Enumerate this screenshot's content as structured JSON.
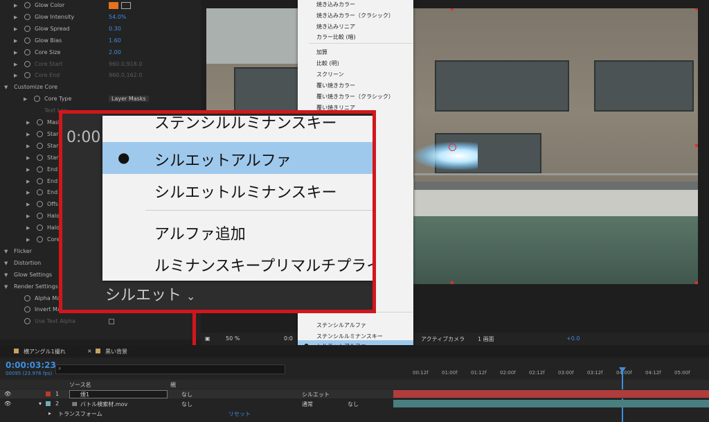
{
  "effect_controls": {
    "rows": [
      {
        "label": "Glow Color",
        "value": "",
        "type": "color"
      },
      {
        "label": "Glow Intensity",
        "value": "54.0%"
      },
      {
        "label": "Glow Spread",
        "value": "0.30"
      },
      {
        "label": "Glow Bias",
        "value": "1.60"
      },
      {
        "label": "Core Size",
        "value": "2.00"
      },
      {
        "label": "Core Start",
        "value": "960.0,918.0",
        "dim": true
      },
      {
        "label": "Core End",
        "value": "960.0,162.0",
        "dim": true
      },
      {
        "label": "Customize Core",
        "value": ""
      },
      {
        "label": "Core Type",
        "value": "Layer Masks"
      },
      {
        "label": "Text Lay",
        "value": "",
        "dim": true
      },
      {
        "label": "Mask",
        "value": ""
      },
      {
        "label": "Star",
        "value": ""
      },
      {
        "label": "Star",
        "value": ""
      },
      {
        "label": "Star",
        "value": ""
      },
      {
        "label": "End",
        "value": ""
      },
      {
        "label": "End",
        "value": ""
      },
      {
        "label": "End",
        "value": ""
      },
      {
        "label": "Offs",
        "value": ""
      },
      {
        "label": "Halo",
        "value": ""
      },
      {
        "label": "Halo",
        "value": ""
      },
      {
        "label": "Core",
        "value": ""
      },
      {
        "label": "Flicker",
        "value": ""
      },
      {
        "label": "Distortion",
        "value": ""
      },
      {
        "label": "Glow Settings",
        "value": ""
      },
      {
        "label": "Render Settings",
        "value": ""
      },
      {
        "label": "Alpha Mode",
        "value": ""
      },
      {
        "label": "Invert Masks",
        "value": ""
      },
      {
        "label": "Use Text Alpha",
        "value": "",
        "dim": true
      }
    ],
    "glow_color": "#e8711f"
  },
  "blend_menu": {
    "items": [
      "焼き込みカラー",
      "焼き込みカラー（クラシック）",
      "焼き込みリニア",
      "カラー比較 (暗)",
      "加算",
      "比較 (明)",
      "スクリーン",
      "覆い焼きカラー",
      "覆い焼きカラー（クラシック）",
      "覆い焼きリニア",
      "ステンシルアルファ",
      "ステンシルルミナンスキー",
      "シルエットアルファ",
      "シルエットルミナンスキー",
      "アルファ追加",
      "ルミナンスキープリマルチプライ"
    ],
    "selected": "シルエットアルファ"
  },
  "callout": {
    "items": [
      "ステンシルルミナンスキー",
      "シルエットアルファ",
      "シルエットルミナンスキー",
      "アルファ追加",
      "ルミナンスキープリマルチプライ"
    ],
    "selected_index": 1,
    "button_label": "シルエット",
    "time_fragment": "0:00"
  },
  "viewer_toolbar": {
    "zoom": "50 %",
    "time_fragment": "0:0",
    "camera": "アクティブカメラ",
    "views": "1 画面",
    "exposure": "+0.0"
  },
  "timeline": {
    "tabs": [
      "横アングル1撮れ",
      "黒い背景"
    ],
    "timecode": "0:00:03:23",
    "fps": "00095 (23.976 fps)",
    "col_source": "ソース名",
    "col_parent": "親",
    "ruler": [
      "00:12f",
      "01:00f",
      "01:12f",
      "02:00f",
      "02:12f",
      "03:00f",
      "03:12f",
      "04:00f",
      "04:12f",
      "05:00f"
    ],
    "layers": [
      {
        "num": "1",
        "name": "煙1",
        "parent": "なし",
        "mode": "シルエット"
      },
      {
        "num": "2",
        "name": "バトル検索材.mov",
        "parent": "なし",
        "mode": "通常",
        "track": "なし"
      }
    ],
    "transform_label": "トランスフォーム",
    "reset_label": "リセット"
  }
}
